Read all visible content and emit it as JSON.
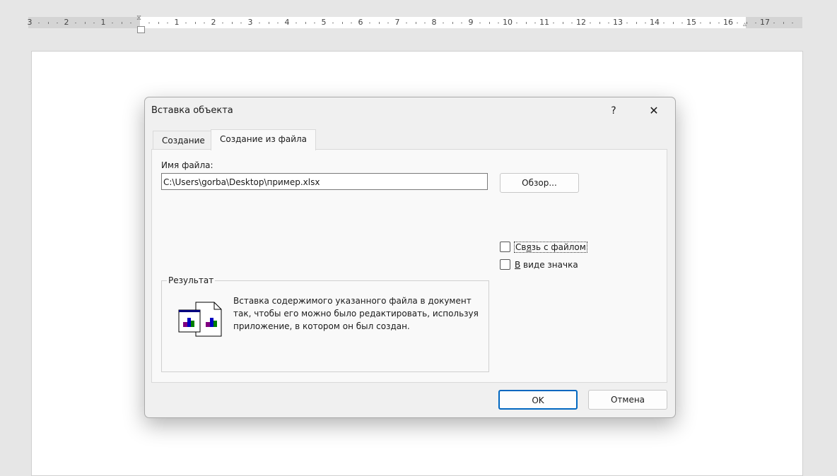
{
  "ruler": {
    "left_numbers": [
      "3",
      "2",
      "1"
    ],
    "right_numbers": [
      "1",
      "2",
      "3",
      "4",
      "5",
      "6",
      "7",
      "8",
      "9",
      "10",
      "11",
      "12",
      "13",
      "14",
      "15",
      "16",
      "17"
    ]
  },
  "dialog": {
    "title": "Вставка объекта",
    "help": "?",
    "close": "✕",
    "tabs": [
      {
        "label": "Создание"
      },
      {
        "label": "Создание из файла"
      }
    ],
    "file_label": "Имя файла:",
    "file_value": "C:\\Users\\gorba\\Desktop\\пример.xlsx",
    "browse": "Обзор...",
    "link_checkbox": {
      "pre": "Св",
      "u": "я",
      "post": "зь с файлом",
      "checked": false
    },
    "icon_checkbox": {
      "u": "В",
      "post": " виде значка",
      "checked": false
    },
    "result_label": "Результат",
    "result_text": "Вставка содержимого указанного файла в документ так, чтобы его можно было редактировать, используя приложение, в котором он был создан.",
    "ok": "OK",
    "cancel": "Отмена"
  }
}
